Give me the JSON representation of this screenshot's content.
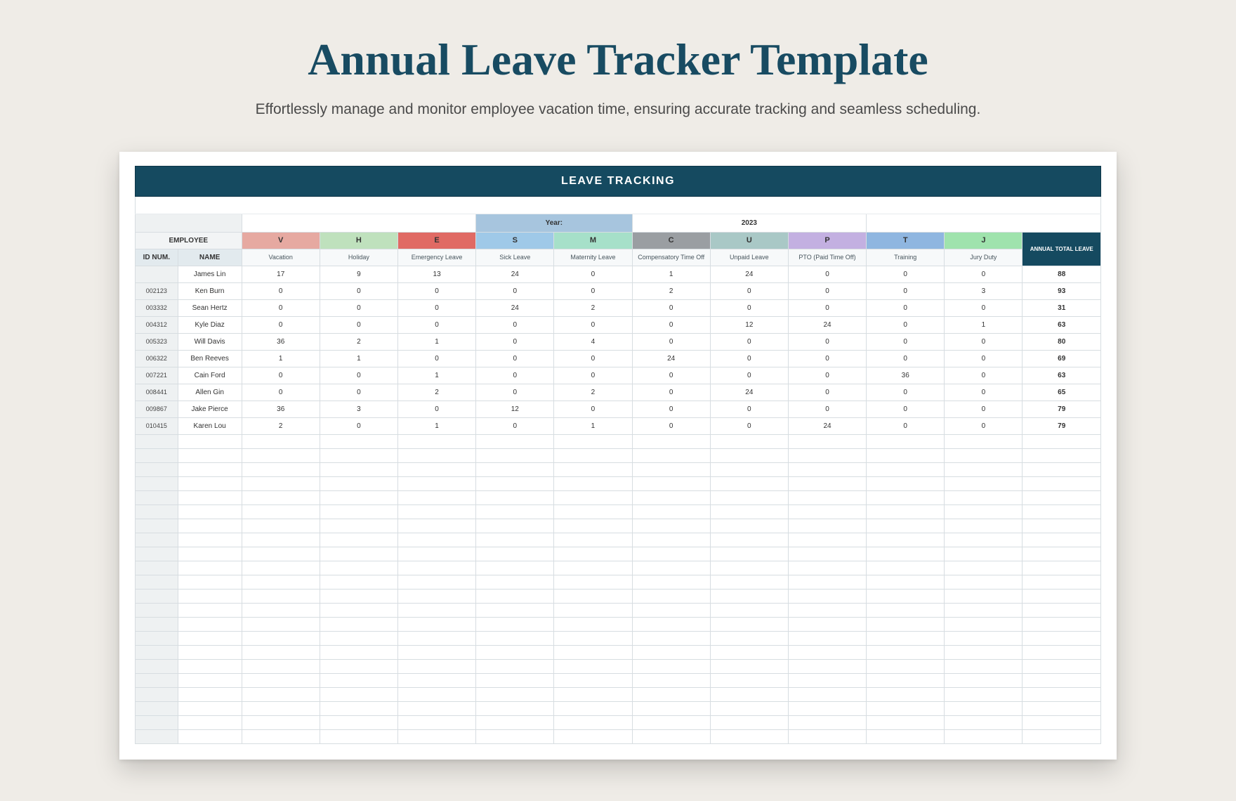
{
  "title": "Annual Leave Tracker Template",
  "subtitle": "Effortlessly manage and monitor employee vacation time, ensuring accurate tracking and seamless scheduling.",
  "banner": "LEAVE TRACKING",
  "year_label": "Year:",
  "year_value": "2023",
  "employee_header": "EMPLOYEE",
  "id_header": "ID NUM.",
  "name_header": "NAME",
  "total_header": "ANNUAL TOTAL LEAVE",
  "leave_types": [
    {
      "code": "V",
      "label": "Vacation",
      "color": "#e6a9a1"
    },
    {
      "code": "H",
      "label": "Holiday",
      "color": "#bfe1bd"
    },
    {
      "code": "E",
      "label": "Emergency Leave",
      "color": "#e06a64"
    },
    {
      "code": "S",
      "label": "Sick Leave",
      "color": "#9fc9e8"
    },
    {
      "code": "M",
      "label": "Maternity Leave",
      "color": "#a6e0c9"
    },
    {
      "code": "C",
      "label": "Compensatory Time Off",
      "color": "#9a9ea2"
    },
    {
      "code": "U",
      "label": "Unpaid Leave",
      "color": "#a9c8c6"
    },
    {
      "code": "P",
      "label": "PTO (Paid Time Off)",
      "color": "#c3b0e1"
    },
    {
      "code": "T",
      "label": "Training",
      "color": "#8fb6e0"
    },
    {
      "code": "J",
      "label": "Jury Duty",
      "color": "#9fe3ad"
    }
  ],
  "rows": [
    {
      "id": "",
      "name": "James Lin",
      "v": [
        17,
        9,
        13,
        24,
        0,
        1,
        24,
        0,
        0,
        0
      ],
      "total": 88
    },
    {
      "id": "002123",
      "name": "Ken Burn",
      "v": [
        0,
        0,
        0,
        0,
        0,
        2,
        0,
        0,
        0,
        3
      ],
      "total": 93
    },
    {
      "id": "003332",
      "name": "Sean Hertz",
      "v": [
        0,
        0,
        0,
        24,
        2,
        0,
        0,
        0,
        0,
        0
      ],
      "total": 31
    },
    {
      "id": "004312",
      "name": "Kyle Diaz",
      "v": [
        0,
        0,
        0,
        0,
        0,
        0,
        12,
        24,
        0,
        1
      ],
      "total": 63
    },
    {
      "id": "005323",
      "name": "Will Davis",
      "v": [
        36,
        2,
        1,
        0,
        4,
        0,
        0,
        0,
        0,
        0
      ],
      "total": 80
    },
    {
      "id": "006322",
      "name": "Ben Reeves",
      "v": [
        1,
        1,
        0,
        0,
        0,
        24,
        0,
        0,
        0,
        0
      ],
      "total": 69
    },
    {
      "id": "007221",
      "name": "Cain Ford",
      "v": [
        0,
        0,
        1,
        0,
        0,
        0,
        0,
        0,
        36,
        0
      ],
      "total": 63
    },
    {
      "id": "008441",
      "name": "Allen Gin",
      "v": [
        0,
        0,
        2,
        0,
        2,
        0,
        24,
        0,
        0,
        0
      ],
      "total": 65
    },
    {
      "id": "009867",
      "name": "Jake Pierce",
      "v": [
        36,
        3,
        0,
        12,
        0,
        0,
        0,
        0,
        0,
        0
      ],
      "total": 79
    },
    {
      "id": "010415",
      "name": "Karen Lou",
      "v": [
        2,
        0,
        1,
        0,
        1,
        0,
        0,
        24,
        0,
        0
      ],
      "total": 79
    }
  ],
  "empty_rows": 22
}
